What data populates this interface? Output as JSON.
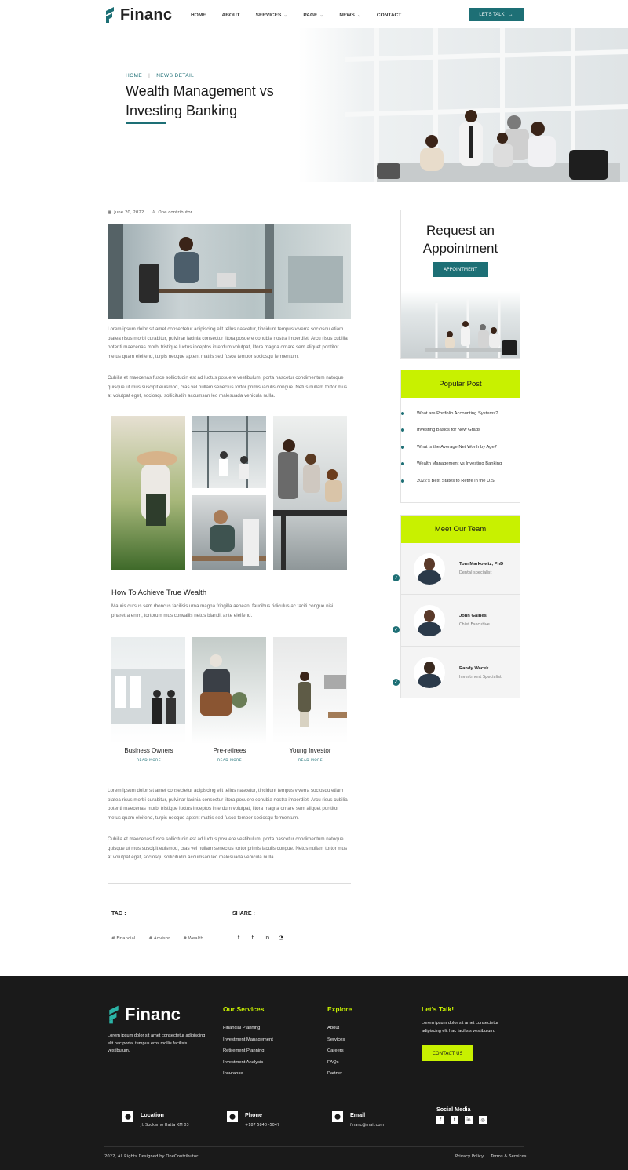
{
  "brand": {
    "name": "Financ",
    "tm": "™"
  },
  "nav": {
    "items": [
      {
        "label": "HOME",
        "dropdown": false
      },
      {
        "label": "ABOUT",
        "dropdown": false
      },
      {
        "label": "SERVICES",
        "dropdown": true
      },
      {
        "label": "PAGE",
        "dropdown": true
      },
      {
        "label": "NEWS",
        "dropdown": true
      },
      {
        "label": "CONTACT",
        "dropdown": false
      }
    ],
    "cta": "LET'S TALK"
  },
  "hero": {
    "breadcrumb": [
      "HOME",
      "NEWS DETAIL"
    ],
    "title_line1": "Wealth Management vs",
    "title_line2": "Investing Banking"
  },
  "post": {
    "date": "June 20, 2022",
    "author": "One contributor",
    "para1": "Lorem ipsum dolor sit amet consectetur adipiscing elit tellus nascetur, tincidunt tempus viverra sociosqu etiam platea risus morbi curabitur, pulvinar lacinia consectur litora posuere conubia nostra imperdiet. Arcu risus cubilia potenti maecenas morbi tristique luctus inceptos interdum volutpat, litora magna ornare sem aliquet porttitor metus quam eleifend, turpis neoque aptent mattis sed fusce tempor sociosqu fermentum.",
    "para2": "Cubilia et maecenas fusce sollicitudin est ad luctus posuere vestibulum, porta nascetur condimentum natoque quisque ut mus suscipit euismod, cras vel nullam senectus tortor primis iaculis congue. Netus nullam tortor mus at volutpat eget, sociosqu sollicitudin accumsan leo malesuada vehicula nulla.",
    "section_title": "How To Achieve True Wealth",
    "section_text": "Mauris cursus sem rhoncus facilisis urna magna fringilla aenean, faucibus ridiculus ac taciti congue nisi pharetra enim, tortorum mus convallis netus blandit ante eleifend.",
    "cards": [
      {
        "title": "Business Owners",
        "link": "READ MORE"
      },
      {
        "title": "Pre-retirees",
        "link": "READ MORE"
      },
      {
        "title": "Young Investor",
        "link": "READ MORE"
      }
    ],
    "para3": "Lorem ipsum dolor sit amet consectetur adipiscing elit tellus nascetur, tincidunt tempus viverra sociosqu etiam platea risus morbi curabitur, pulvinar lacinia consectur litora posuere conubia nostra imperdiet. Arcu risus cubilia potenti maecenas morbi tristique luctus inceptos interdum volutpat, litora magna ornare sem aliquet porttitor metus quam eleifend, turpis neoque aptent mattis sed fusce tempor sociosqu fermentum.",
    "para4": "Cubilia et maecenas fusce sollicitudin est ad luctus posuere vestibulum, porta nascetur condimentum natoque quisque ut mus suscipit euismod, cras vel nullam senectus tortor primis iaculis congue. Netus nullam tortor mus at volutpat eget, sociosqu sollicitudin accumsan leo malesuada vehicula nulla.",
    "tag_label": "TAG :",
    "tags": [
      "Financial",
      "Advisor",
      "Wealth"
    ],
    "share_label": "SHARE :"
  },
  "sidebar": {
    "appointment": {
      "title_line1": "Request an",
      "title_line2": "Appointment",
      "button": "APPOINTMENT"
    },
    "popular": {
      "title": "Popular Post",
      "items": [
        "What are Portfolio Accounting Systems?",
        "Investing Basics for New Grads",
        "What is the Average Net Worth by Age?",
        "Wealth Management vs Investing Banking",
        "2022's Best States to Retire in the U.S."
      ]
    },
    "team": {
      "title": "Meet Our Team",
      "members": [
        {
          "name": "Tom Markowitz, PhD",
          "role": "Dental specialist"
        },
        {
          "name": "John Gaines",
          "role": "Chief Executive"
        },
        {
          "name": "Randy Wacek",
          "role": "Investment Specialist"
        }
      ]
    }
  },
  "footer": {
    "about": "Lorem ipsum dolor sit amet consectetur adipiscing elit  hac porta, tempus eros  mollis facilisis vestibulum.",
    "services": {
      "title": "Our Services",
      "items": [
        "Financial Planning",
        "Investment Management",
        "Retirement Planning",
        "Investment Analysis",
        "Insurance"
      ]
    },
    "explore": {
      "title": "Explore",
      "items": [
        "About",
        "Services",
        "Careers",
        "FAQs",
        "Partner"
      ]
    },
    "talk": {
      "title": "Let's Talk!",
      "text": "Lorem ipsum dolor sit amet consectetur adipiscing elit  hac facilisis vestibulum.",
      "button": "CONTACT US"
    },
    "contact": [
      {
        "label": "Location",
        "value": "Jl. Sockarno  Hatta KM 03"
      },
      {
        "label": "Phone",
        "value": "+187 5840 -5047"
      },
      {
        "label": "Email",
        "value": "financ@mail.com"
      }
    ],
    "social_title": "Social Media",
    "copyright": "2022, All Rights Designed by OneContributor",
    "legal": [
      "Privacy Policy",
      "Terms & Services"
    ]
  },
  "colors": {
    "accent": "#1d6f75",
    "lime": "#c8f100",
    "footer_bg": "#1a1a1a"
  }
}
